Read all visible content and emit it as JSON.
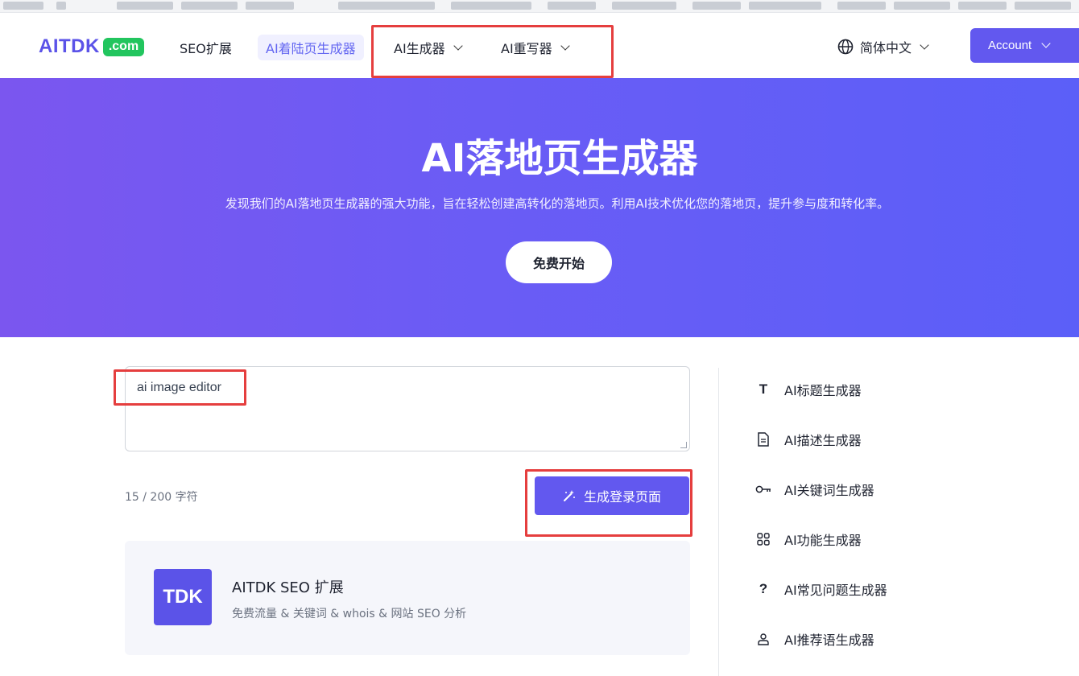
{
  "header": {
    "logo_text": "AITDK",
    "logo_badge": ".com",
    "nav": [
      {
        "label": "SEO扩展"
      },
      {
        "label": "AI着陆页生成器"
      },
      {
        "label": "AI生成器"
      },
      {
        "label": "AI重写器"
      }
    ],
    "language": "简体中文",
    "account": "Account"
  },
  "hero": {
    "title": "AI落地页生成器",
    "subtitle": "发现我们的AI落地页生成器的强大功能，旨在轻松创建高转化的落地页。利用AI技术优化您的落地页，提升参与度和转化率。",
    "cta": "免费开始"
  },
  "main": {
    "input_value": "ai image editor",
    "char_count": "15 / 200 字符",
    "generate_button": "生成登录页面"
  },
  "promo": {
    "logo": "TDK",
    "title": "AITDK SEO 扩展",
    "desc": "免费流量 & 关键词 & whois & 网站 SEO 分析"
  },
  "sidebar": {
    "items": [
      {
        "label": "AI标题生成器",
        "icon": "title-icon"
      },
      {
        "label": "AI描述生成器",
        "icon": "document-icon"
      },
      {
        "label": "AI关键词生成器",
        "icon": "key-icon"
      },
      {
        "label": "AI功能生成器",
        "icon": "grid-icon"
      },
      {
        "label": "AI常见问题生成器",
        "icon": "question-icon"
      },
      {
        "label": "AI推荐语生成器",
        "icon": "person-icon"
      }
    ]
  },
  "colors": {
    "accent": "#6258ef",
    "brand_green": "#22c55e",
    "annotation_red": "#e53e3e"
  }
}
